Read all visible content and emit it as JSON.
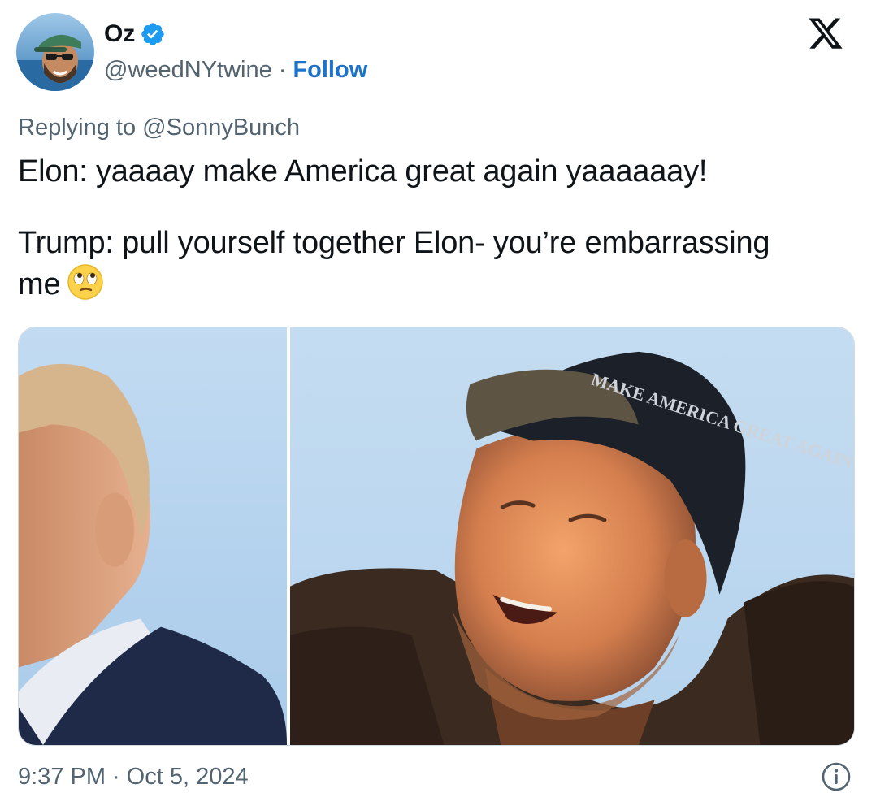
{
  "author": {
    "display_name": "Oz",
    "handle": "@weedNYtwine",
    "separator": "·",
    "follow_label": "Follow",
    "verified": true,
    "avatar_icon": "profile-avatar"
  },
  "header": {
    "logo_icon": "x-logo-icon"
  },
  "reply": {
    "prefix": "Replying to",
    "to_handle": "@SonnyBunch"
  },
  "tweet": {
    "line1": "Elon: yaaaay make America great again yaaaaaay!",
    "line2": "Trump: pull yourself together Elon- you’re embarrassing",
    "line3": "me",
    "emoji": "face-with-rolling-eyes-emoji"
  },
  "media": {
    "photos": [
      {
        "name": "photo-left",
        "subject": "trump-profile"
      },
      {
        "name": "photo-right",
        "subject": "elon-in-cap",
        "cap_text": "MAKE AMERICA GREAT AGAIN"
      }
    ]
  },
  "footer": {
    "time": "9:37 PM",
    "separator": "·",
    "date": "Oct 5, 2024",
    "info_icon": "info-icon"
  },
  "colors": {
    "text_primary": "#0f1419",
    "text_secondary": "#536471",
    "link": "#1d72c9",
    "verified_badge": "#1d9bf0",
    "border": "#cfd9de"
  }
}
